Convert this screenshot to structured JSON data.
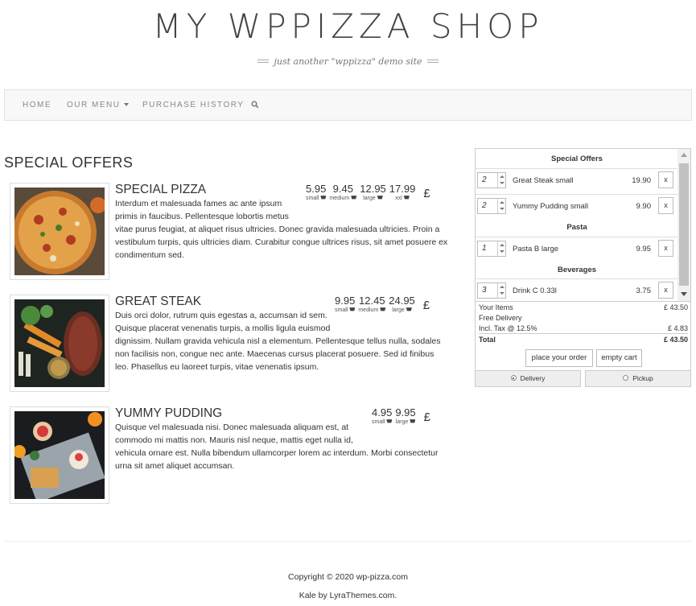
{
  "site": {
    "title": "MY WPPIZZA SHOP",
    "tagline": "just another \"wppizza\" demo site"
  },
  "nav": {
    "items": [
      {
        "label": "HOME"
      },
      {
        "label": "OUR MENU"
      },
      {
        "label": "PURCHASE HISTORY"
      }
    ]
  },
  "section": {
    "title": "SPECIAL OFFERS"
  },
  "menu_items": [
    {
      "title": "SPECIAL PIZZA",
      "desc_lines": [
        "Interdum et malesuada fames ac ante ipsum",
        "primis in faucibus. Pellentesque lobortis metus",
        "vitae purus feugiat, at aliquet risus ultricies. Donec gravida malesuada ultricies. Proin a",
        "vestibulum turpis, quis ultricies diam. Curabitur congue ultrices risus, sit amet posuere ex",
        "condimentum sed."
      ],
      "prices": [
        {
          "amount": "5.95",
          "size": "small"
        },
        {
          "amount": "9.45",
          "size": "medium"
        },
        {
          "amount": "12.95",
          "size": "large"
        },
        {
          "amount": "17.99",
          "size": "xxl"
        }
      ],
      "currency": "£"
    },
    {
      "title": "GREAT STEAK",
      "desc_lines": [
        "Duis orci dolor, rutrum quis egestas a, accumsan id sem.",
        "Quisque placerat venenatis turpis, a mollis ligula euismod",
        "dignissim. Nullam gravida vehicula nisl a elementum. Pellentesque tellus nulla, sodales",
        "non facilisis non, congue nec ante. Maecenas cursus placerat posuere. Sed id finibus",
        "leo. Phasellus eu laoreet turpis, vitae venenatis ipsum."
      ],
      "prices": [
        {
          "amount": "9.95",
          "size": "small"
        },
        {
          "amount": "12.45",
          "size": "medium"
        },
        {
          "amount": "24.95",
          "size": "large"
        }
      ],
      "currency": "£"
    },
    {
      "title": "YUMMY PUDDING",
      "desc_lines": [
        "Quisque vel malesuada nisi. Donec malesuada aliquam est, at",
        "commodo mi mattis non. Mauris nisl neque, mattis eget nulla id,",
        "vehicula ornare est. Nulla bibendum ullamcorper lorem ac interdum. Morbi consectetur",
        "urna sit amet aliquet accumsan."
      ],
      "prices": [
        {
          "amount": "4.95",
          "size": "small"
        },
        {
          "amount": "9.95",
          "size": "large"
        }
      ],
      "currency": "£"
    }
  ],
  "cart": {
    "groups": [
      {
        "name": "Special Offers",
        "rows": [
          {
            "qty": "2",
            "name": "Great Steak small",
            "price": "19.90",
            "remove": "x"
          },
          {
            "qty": "2",
            "name": "Yummy Pudding small",
            "price": "9.90",
            "remove": "x"
          }
        ]
      },
      {
        "name": "Pasta",
        "rows": [
          {
            "qty": "1",
            "name": "Pasta B large",
            "price": "9.95",
            "remove": "x"
          }
        ]
      },
      {
        "name": "Beverages",
        "rows": [
          {
            "qty": "3",
            "name": "Drink C 0.33l",
            "price": "3.75",
            "remove": "x"
          }
        ]
      }
    ],
    "summary": {
      "items_label": "Your Items",
      "items_value": "£ 43.50",
      "delivery_label": "Free Delivery",
      "tax_label": "Incl. Tax @ 12.5%",
      "tax_value": "£ 4.83",
      "total_label": "Total",
      "total_value": "£ 43.50"
    },
    "buttons": {
      "order": "place your order",
      "empty": "empty cart"
    },
    "tabs": {
      "delivery": "Delivery",
      "pickup": "Pickup"
    }
  },
  "footer": {
    "copyright": "Copyright © 2020 wp-pizza.com",
    "credit": "Kale by LyraThemes.com."
  }
}
